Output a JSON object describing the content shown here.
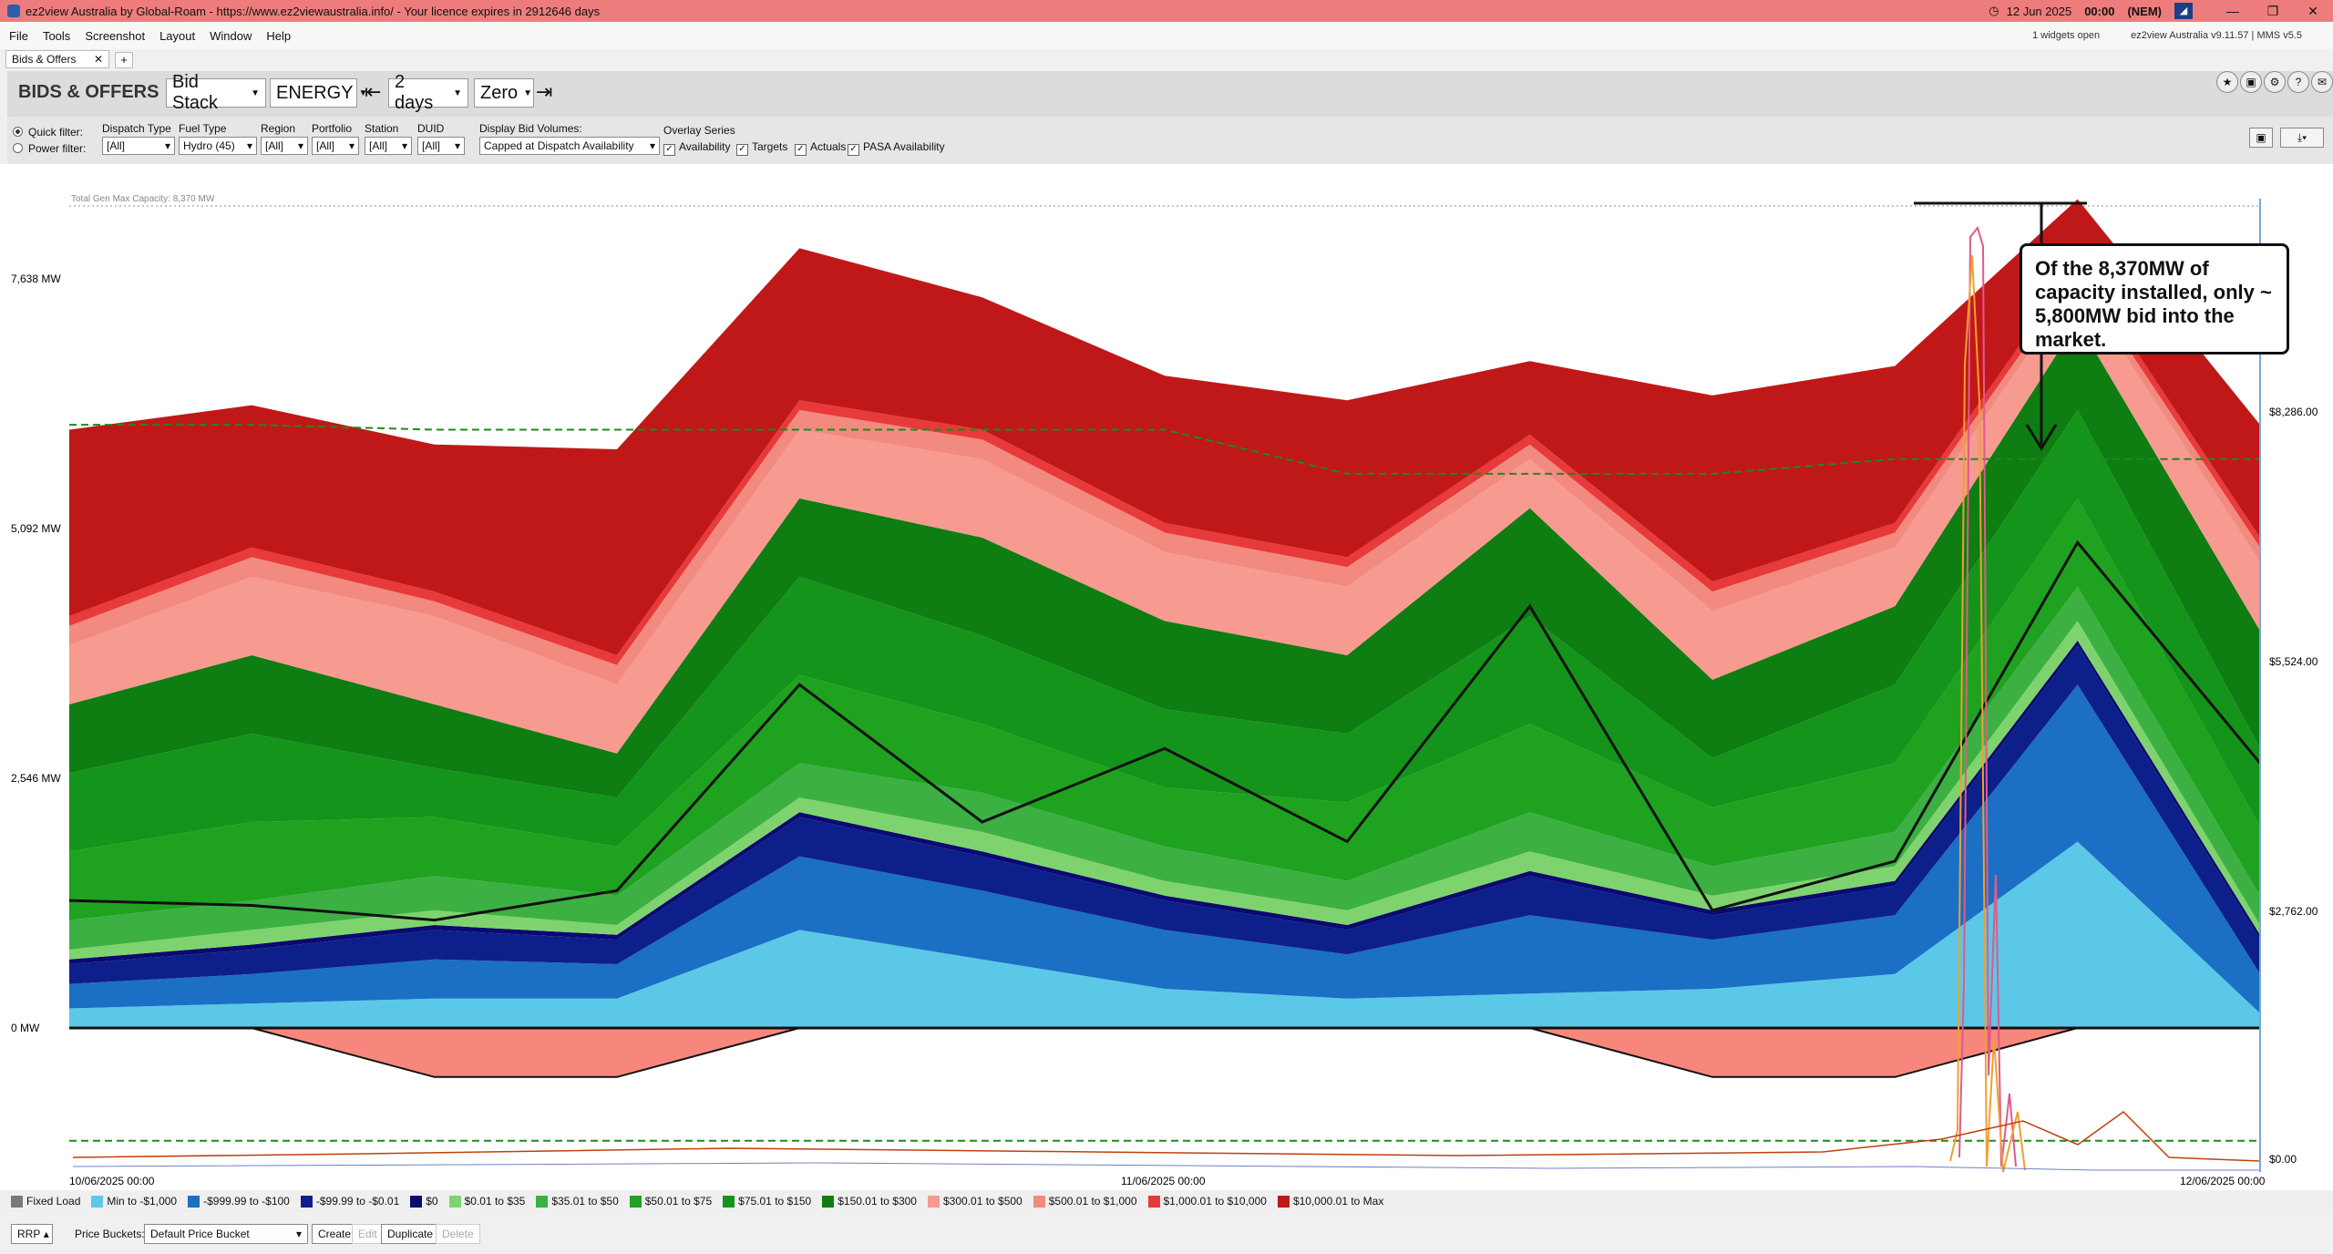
{
  "window": {
    "title": "ez2view Australia by Global-Roam - https://www.ez2viewaustralia.info/ - Your licence expires in 2912646 days",
    "date": "12 Jun 2025",
    "time": "00:00",
    "zone": "(NEM)"
  },
  "menu": [
    "File",
    "Tools",
    "Screenshot",
    "Layout",
    "Window",
    "Help"
  ],
  "status_info": {
    "widgets": "1 widgets open",
    "version": "ez2view Australia v9.11.57 | MMS v5.5"
  },
  "tab": {
    "label": "Bids & Offers",
    "add": "+"
  },
  "toolbar": {
    "title": "BIDS & OFFERS",
    "view": "Bid Stack",
    "market": "ENERGY",
    "span": "2 days",
    "baseline": "Zero"
  },
  "filters": {
    "quick_filter": "Quick filter:",
    "power_filter": "Power filter:",
    "dispatch_type": {
      "label": "Dispatch Type",
      "value": "[All]"
    },
    "fuel_type": {
      "label": "Fuel Type",
      "value": "Hydro (45)"
    },
    "region": {
      "label": "Region",
      "value": "[All]"
    },
    "portfolio": {
      "label": "Portfolio",
      "value": "[All]"
    },
    "station": {
      "label": "Station",
      "value": "[All]"
    },
    "duid": {
      "label": "DUID",
      "value": "[All]"
    },
    "display_bid_volumes": {
      "label": "Display Bid Volumes:",
      "value": "Capped at Dispatch Availability"
    },
    "overlay": {
      "label": "Overlay Series",
      "items": [
        "Availability",
        "Targets",
        "Actuals",
        "PASA Availability"
      ]
    }
  },
  "chart_data": {
    "type": "area",
    "max_capacity_label": "Total Gen Max Capacity: 8,370 MW",
    "y_left_ticks": [
      "7,638 MW",
      "5,092 MW",
      "2,546 MW",
      "0 MW"
    ],
    "y_right_ticks": [
      "$8,286.00",
      "$5,524.00",
      "$2,762.00",
      "$0.00"
    ],
    "x_ticks": [
      "10/06/2025 00:00",
      "11/06/2025 00:00",
      "12/06/2025 00:00"
    ],
    "ylim": [
      -1500,
      8400
    ],
    "x": [
      0,
      4,
      8,
      12,
      16,
      20,
      24,
      28,
      32,
      36,
      40,
      44,
      48
    ],
    "series": [
      {
        "name": "Min to -$1,000",
        "color": "#5bc8e8",
        "values": [
          200,
          250,
          300,
          300,
          1000,
          700,
          400,
          300,
          350,
          400,
          550,
          1900,
          150
        ]
      },
      {
        "name": "-$999.99 to -$100",
        "color": "#1b6fc4",
        "values": [
          250,
          300,
          400,
          350,
          750,
          700,
          600,
          450,
          800,
          500,
          600,
          1600,
          400
        ]
      },
      {
        "name": "-$99.99 to -$0.01",
        "color": "#0d1f8a",
        "values": [
          200,
          250,
          300,
          250,
          400,
          350,
          300,
          250,
          400,
          250,
          300,
          400,
          350
        ]
      },
      {
        "name": "$0",
        "color": "#0a0a70",
        "values": [
          50,
          50,
          50,
          50,
          50,
          50,
          50,
          50,
          50,
          50,
          50,
          50,
          50
        ]
      },
      {
        "name": "$0.01 to $35",
        "color": "#7fd36e",
        "values": [
          100,
          150,
          150,
          100,
          150,
          200,
          150,
          150,
          200,
          150,
          150,
          200,
          100
        ]
      },
      {
        "name": "$35.01 to $50",
        "color": "#3cb043",
        "values": [
          300,
          300,
          350,
          300,
          350,
          400,
          350,
          300,
          400,
          300,
          350,
          350,
          300
        ]
      },
      {
        "name": "$50.01 to $75",
        "color": "#1fa21f",
        "values": [
          700,
          800,
          600,
          500,
          900,
          700,
          600,
          800,
          900,
          600,
          700,
          900,
          700
        ]
      },
      {
        "name": "$75.01 to $150",
        "color": "#14941a",
        "values": [
          800,
          900,
          500,
          500,
          1000,
          900,
          800,
          700,
          1100,
          500,
          800,
          900,
          800
        ]
      },
      {
        "name": "$150.01 to $300",
        "color": "#0e7d12",
        "values": [
          700,
          800,
          650,
          450,
          800,
          1000,
          900,
          800,
          1100,
          800,
          800,
          900,
          1200
        ]
      },
      {
        "name": "$300.01 to $500",
        "color": "#f79a90",
        "values": [
          600,
          800,
          900,
          700,
          700,
          800,
          700,
          700,
          500,
          700,
          600,
          400,
          700
        ]
      },
      {
        "name": "$500.01 to $1,000",
        "color": "#f28a80",
        "values": [
          200,
          200,
          150,
          200,
          200,
          200,
          200,
          200,
          150,
          200,
          150,
          100,
          150
        ]
      },
      {
        "name": "$1,000.01 to $10,000",
        "color": "#e83a3a",
        "values": [
          100,
          100,
          100,
          100,
          100,
          100,
          100,
          100,
          100,
          100,
          100,
          100,
          100
        ]
      },
      {
        "name": "$10,000.01 to Max",
        "color": "#c01818",
        "values": [
          1900,
          1450,
          1500,
          2100,
          1550,
          1350,
          1500,
          1600,
          750,
          1900,
          1600,
          650,
          1150
        ]
      }
    ],
    "availability_line": [
      6150,
      6150,
      6100,
      6100,
      6100,
      6100,
      6100,
      5650,
      5650,
      5650,
      5800,
      5800,
      5800
    ],
    "target_line": [
      1300,
      1250,
      1100,
      1400,
      3500,
      2100,
      2850,
      1900,
      4300,
      1200,
      1700,
      4950,
      2700
    ],
    "negative_band": [
      0,
      0,
      -500,
      -500,
      0,
      0,
      0,
      0,
      0,
      -500,
      -500,
      0,
      0
    ],
    "negative_availability": -1150
  },
  "callout": {
    "text": "Of the 8,370MW of capacity installed, only ~ 5,800MW bid into the market."
  },
  "legend": [
    {
      "label": "Fixed Load",
      "color": "#7a7a7a"
    },
    {
      "label": "Min to -$1,000",
      "color": "#5bc8e8"
    },
    {
      "label": "-$999.99 to -$100",
      "color": "#1b6fc4"
    },
    {
      "label": "-$99.99 to -$0.01",
      "color": "#0d1f8a"
    },
    {
      "label": "$0",
      "color": "#0a0a70"
    },
    {
      "label": "$0.01 to $35",
      "color": "#7fd36e"
    },
    {
      "label": "$35.01 to $50",
      "color": "#3cb043"
    },
    {
      "label": "$50.01 to $75",
      "color": "#1fa21f"
    },
    {
      "label": "$75.01 to $150",
      "color": "#14941a"
    },
    {
      "label": "$150.01 to $300",
      "color": "#0e7d12"
    },
    {
      "label": "$300.01 to $500",
      "color": "#f79a90"
    },
    {
      "label": "$500.01 to $1,000",
      "color": "#f28a80"
    },
    {
      "label": "$1,000.01 to $10,000",
      "color": "#e83a3a"
    },
    {
      "label": "$10,000.01 to Max",
      "color": "#c01818"
    }
  ],
  "bottom": {
    "rrp": "RRP",
    "price_buckets_label": "Price Buckets:",
    "price_bucket": "Default Price Bucket",
    "create": "Create",
    "edit": "Edit",
    "duplicate": "Duplicate",
    "delete": "Delete"
  }
}
